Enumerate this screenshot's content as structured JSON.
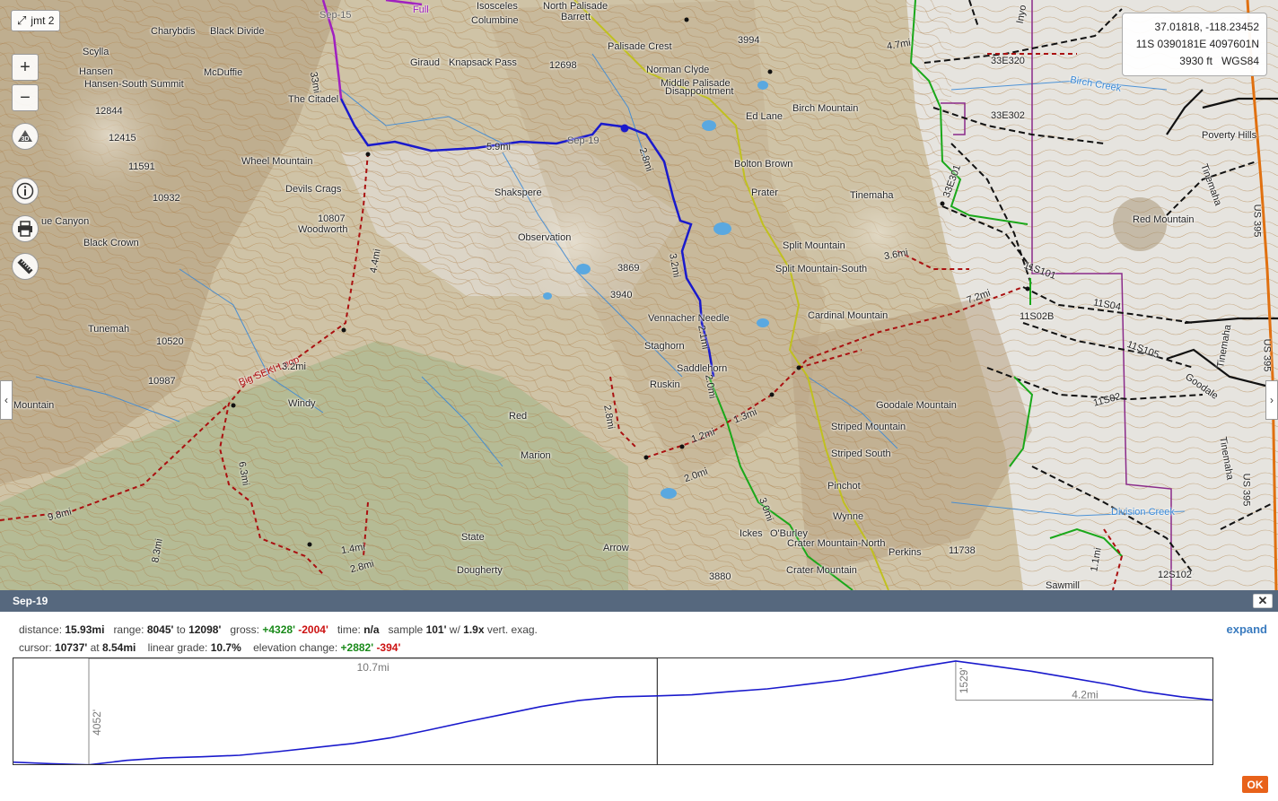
{
  "map": {
    "layer_button": {
      "label": "jmt 2",
      "icon": "expand-arrow-icon"
    },
    "controls": {
      "zoom_in": "+",
      "zoom_out": "−",
      "three_d": "3D"
    },
    "coordinates": {
      "latlon": "37.01818, -118.23452",
      "utm": "11S 0390181E 4097601N",
      "elevation": "3930 ft",
      "datum": "WGS84"
    },
    "peaks": [
      {
        "name": "Isosceles"
      },
      {
        "name": "North Palisade"
      },
      {
        "name": "Barrett"
      },
      {
        "name": "Columbine"
      },
      {
        "name": "Charybdis"
      },
      {
        "name": "Black Divide"
      },
      {
        "name": "Scylla"
      },
      {
        "name": "Hansen"
      },
      {
        "name": "Hansen-South Summit"
      },
      {
        "name": "McDuffie"
      },
      {
        "name": "Giraud"
      },
      {
        "name": "Knapsack Pass"
      },
      {
        "name": "12698"
      },
      {
        "name": "Palisade Crest"
      },
      {
        "name": "3994"
      },
      {
        "name": "Norman Clyde"
      },
      {
        "name": "Middle Palisade"
      },
      {
        "name": "Disappointment"
      },
      {
        "name": "The Citadel"
      },
      {
        "name": "12844"
      },
      {
        "name": "Ed Lane"
      },
      {
        "name": "Birch Mountain"
      },
      {
        "name": "12415"
      },
      {
        "name": "11591"
      },
      {
        "name": "Wheel Mountain"
      },
      {
        "name": "Devils Crags"
      },
      {
        "name": "Bolton Brown"
      },
      {
        "name": "Poverty Hills"
      },
      {
        "name": "Shakspere"
      },
      {
        "name": "Prater"
      },
      {
        "name": "Tinemaha"
      },
      {
        "name": "10932"
      },
      {
        "name": "10807"
      },
      {
        "name": "Woodworth"
      },
      {
        "name": "Observation"
      },
      {
        "name": "Red Mountain"
      },
      {
        "name": "Split Mountain"
      },
      {
        "name": "Split Mountain-South"
      },
      {
        "name": "Black Crown"
      },
      {
        "name": "3869"
      },
      {
        "name": "3940"
      },
      {
        "name": "Cardinal Mountain"
      },
      {
        "name": "Vennacher Needle"
      },
      {
        "name": "Tunemah"
      },
      {
        "name": "10520"
      },
      {
        "name": "Staghorn"
      },
      {
        "name": "Saddlehorn"
      },
      {
        "name": "10987"
      },
      {
        "name": "Ruskin"
      },
      {
        "name": "Mountain"
      },
      {
        "name": "Windy"
      },
      {
        "name": "Goodale Mountain"
      },
      {
        "name": "Red"
      },
      {
        "name": "Striped Mountain"
      },
      {
        "name": "Marion"
      },
      {
        "name": "Striped South"
      },
      {
        "name": "Pinchot"
      },
      {
        "name": "Wynne"
      },
      {
        "name": "State"
      },
      {
        "name": "Ickes"
      },
      {
        "name": "O'Burley"
      },
      {
        "name": "Crater Mountain-North"
      },
      {
        "name": "Perkins"
      },
      {
        "name": "11738"
      },
      {
        "name": "Arrow"
      },
      {
        "name": "Dougherty"
      },
      {
        "name": "3880"
      },
      {
        "name": "Crater Mountain"
      },
      {
        "name": "Sawmill"
      },
      {
        "name": "ue Canyon"
      }
    ],
    "route_labels": [
      {
        "text": "Sep-15"
      },
      {
        "text": "Full"
      },
      {
        "text": "Sep-19"
      },
      {
        "text": "5.9mi"
      },
      {
        "text": "2.8mi"
      },
      {
        "text": "3.2mi"
      },
      {
        "text": "4.4mi"
      },
      {
        "text": "Big SEKI Loop"
      },
      {
        "text": "3.2mi"
      },
      {
        "text": "2.1mi"
      },
      {
        "text": "2.0mi"
      },
      {
        "text": "1.3mi"
      },
      {
        "text": "1.2mi"
      },
      {
        "text": "2.0mi"
      },
      {
        "text": "3.0mi"
      },
      {
        "text": "6.3mi"
      },
      {
        "text": "9.8mi"
      },
      {
        "text": "8.3mi"
      },
      {
        "text": "1.4mi"
      },
      {
        "text": "2.8mi"
      },
      {
        "text": "2.8mi"
      },
      {
        "text": "4.7mi"
      },
      {
        "text": "3.6mi"
      },
      {
        "text": "7.2mi"
      },
      {
        "text": "1.1mi"
      },
      {
        "text": "33mi"
      }
    ],
    "road_labels": [
      {
        "text": "33E320"
      },
      {
        "text": "33E302"
      },
      {
        "text": "33E301"
      },
      {
        "text": "11S101"
      },
      {
        "text": "11S04"
      },
      {
        "text": "11S02B"
      },
      {
        "text": "11S105"
      },
      {
        "text": "11S02"
      },
      {
        "text": "12S102"
      },
      {
        "text": "US 395"
      },
      {
        "text": "US 395"
      },
      {
        "text": "US 395"
      },
      {
        "text": "Tinemaha"
      },
      {
        "text": "Tinemaha"
      },
      {
        "text": "Tinemaha"
      },
      {
        "text": "Goodale"
      },
      {
        "text": "Division Creek"
      },
      {
        "text": "Birch Creek"
      },
      {
        "text": "Inyo"
      }
    ],
    "colors": {
      "primary_route": "#1a1acc",
      "secondary_route": "#a020c0",
      "green_trail": "#1aa81a",
      "dashed_trail": "#aa1111",
      "yellow_trail": "#c0c020",
      "road": "#111111",
      "highway": "#e07010",
      "boundary": "#8a2a8a"
    }
  },
  "panel": {
    "title": "Sep-19",
    "close": "✕",
    "expand": "expand",
    "ok": "OK",
    "stats": {
      "distance_label": "distance:",
      "distance": "15.93mi",
      "range_label": "range:",
      "range_low": "8045'",
      "range_to": "to",
      "range_high": "12098'",
      "gross_label": "gross:",
      "gross_gain": "+4328'",
      "gross_loss": "-2004'",
      "time_label": "time:",
      "time": "n/a",
      "sample_label": "sample",
      "sample": "101'",
      "w_label": "w/",
      "exag": "1.9x",
      "exag_label": "vert. exag.",
      "cursor_label": "cursor:",
      "cursor_elev": "10737'",
      "at_label": "at",
      "cursor_dist": "8.54mi",
      "grade_label": "linear grade:",
      "grade": "10.7%",
      "elev_change_label": "elevation change:",
      "elev_gain": "+2882'",
      "elev_loss": "-394'"
    },
    "chart_labels": {
      "segment_a": "10.7mi",
      "gain_a": "4052'",
      "segment_b": "4.2mi",
      "gain_b": "1529'"
    }
  },
  "chart_data": {
    "type": "line",
    "title": "",
    "xlabel": "",
    "ylabel": "",
    "x": [
      0,
      0.5,
      1.0,
      1.5,
      2.0,
      2.5,
      3.0,
      3.5,
      4.0,
      4.5,
      5.0,
      5.5,
      6.0,
      6.5,
      7.0,
      7.5,
      8.0,
      8.54,
      9.0,
      9.5,
      10.0,
      10.5,
      11.0,
      11.5,
      12.0,
      12.5,
      13.0,
      13.5,
      14.0,
      14.5,
      15.0,
      15.5,
      15.93
    ],
    "series": [
      {
        "values": [
          8150,
          8090,
          8045,
          8220,
          8320,
          8360,
          8420,
          8560,
          8720,
          8880,
          9100,
          9400,
          9720,
          10020,
          10320,
          10560,
          10700,
          10737,
          10780,
          10900,
          11010,
          11180,
          11360,
          11600,
          11860,
          12098,
          11900,
          11700,
          11450,
          11200,
          10900,
          10700,
          10569
        ]
      }
    ],
    "markers": [
      {
        "label": "4052'",
        "x": 1.0
      },
      {
        "label": "10.7mi",
        "x_start": 1.0,
        "x_end": 8.54
      },
      {
        "label": "1529'",
        "x": 12.5
      },
      {
        "label": "4.2mi",
        "x_start": 12.5,
        "x_end": 15.93
      },
      {
        "label": "cursor",
        "x": 8.54
      }
    ],
    "xlim": [
      0,
      15.93
    ],
    "ylim": [
      8000,
      12200
    ]
  }
}
